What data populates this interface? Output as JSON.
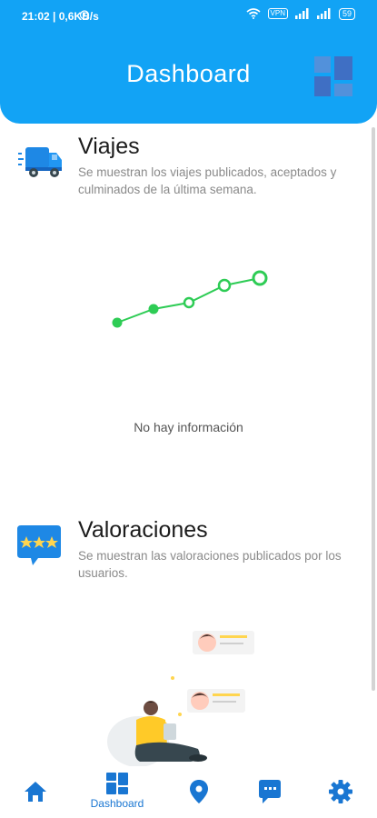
{
  "status_bar": {
    "time": "21:02 | 0,6KB/s",
    "vpn": "VPN",
    "battery": "59"
  },
  "header": {
    "title": "Dashboard"
  },
  "viajes": {
    "title": "Viajes",
    "description": "Se muestran los viajes publicados, aceptados y culminados de la última semana.",
    "empty_text": "No hay información"
  },
  "valoraciones": {
    "title": "Valoraciones",
    "description": "Se muestran las valoraciones publicados por los usuarios."
  },
  "bottom_nav": {
    "active_label": "Dashboard"
  },
  "colors": {
    "primary": "#12a3f5",
    "nav_blue": "#1976d2",
    "chart_green": "#2ecc55"
  },
  "icons": {
    "home": "home-icon",
    "dashboard": "dashboard-icon",
    "location": "location-pin-icon",
    "chat": "chat-icon",
    "settings": "gear-icon"
  }
}
